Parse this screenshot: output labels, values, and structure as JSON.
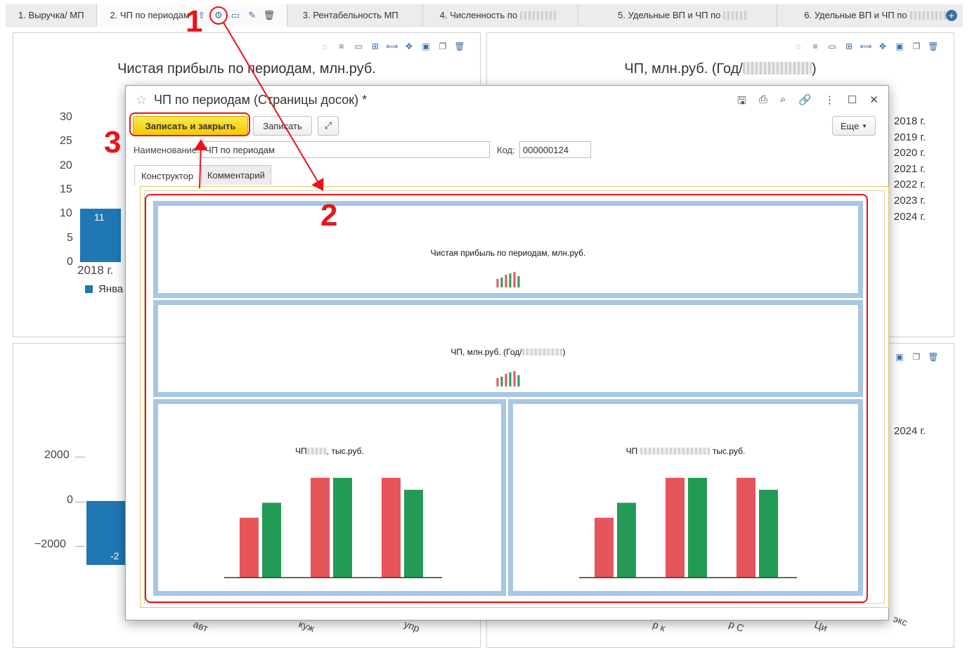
{
  "tabs": [
    {
      "label": "1. Выручка/ МП",
      "active": false,
      "blurred": false
    },
    {
      "label": "2. ЧП по периодам",
      "active": true,
      "blurred": false
    },
    {
      "label": "3. Рентабельность МП",
      "active": false,
      "blurred": false
    },
    {
      "label": "4. Численность по",
      "active": false,
      "blurred": true
    },
    {
      "label": "5. Удельные ВП и ЧП по",
      "active": false,
      "blurred": true
    },
    {
      "label": "6. Удельные ВП и ЧП по",
      "active": false,
      "blurred": true
    }
  ],
  "tab_icons": [
    "export-icon",
    "gear-icon",
    "comment-icon",
    "pencil-icon",
    "delete-icon"
  ],
  "panels": {
    "top_left": {
      "title": "Чистая прибыль по периодам, млн.руб.",
      "y_ticks": [
        "30",
        "25",
        "20",
        "15",
        "10",
        "5",
        "0"
      ],
      "x_category": "2018 г.",
      "bar_label": "11",
      "bar_value": 11,
      "legend_partial": "Янва"
    },
    "top_right": {
      "title": "ЧП, млн.руб. (Год/",
      "title_suffix": ")",
      "legend": [
        "2018 г.",
        "2019 г.",
        "2020 г.",
        "2021 г.",
        "2022 г.",
        "2023 г.",
        "2024 г."
      ],
      "legend_colors": [
        "#1f77b4",
        "#ff7f0e",
        "#2ca02c",
        "#d62728",
        "#9467bd",
        "#e377c2",
        "#7f7f7f"
      ]
    },
    "bottom_left": {
      "y_ticks": [
        "2000",
        "0",
        "−2000"
      ],
      "bar_label": "-2",
      "x_fragments": [
        "авт",
        "куж",
        "упр"
      ]
    },
    "bottom_right": {
      "legend": [
        "2024 г."
      ],
      "x_fragments": [
        "р к",
        "р С",
        "Ци",
        "экс"
      ]
    }
  },
  "modal": {
    "title": "ЧП по периодам (Страницы досок) *",
    "buttons": {
      "save_close": "Записать и закрыть",
      "save": "Записать",
      "more": "Еще"
    },
    "fields": {
      "name_label": "Наименование:",
      "name_value": "ЧП по периодам",
      "code_label": "Код:",
      "code_value": "000000124"
    },
    "tabs": [
      "Конструктор",
      "Комментарий"
    ],
    "blocks": [
      {
        "title": "Чистая прибыль по периодам, млн.руб."
      },
      {
        "title": "ЧП, млн.руб. (Год/",
        "title_suffix": ")"
      },
      {
        "title_prefix": "ЧП",
        "title": ", тыс.руб."
      },
      {
        "title_prefix": "ЧП",
        "title": " тыс.руб."
      }
    ],
    "bar_series": {
      "red": [
        60,
        100,
        100
      ],
      "green": [
        75,
        100,
        88
      ]
    }
  },
  "annotations": [
    "1",
    "2",
    "3"
  ],
  "colors": {
    "accent": "#3a6ea5",
    "annotation": "#e8141b",
    "primary_button": "#f6c900",
    "block_border": "#a8c7e3",
    "bar_blue": "#1f77b4",
    "bar_red": "#e5555a",
    "bar_green": "#239b56"
  }
}
